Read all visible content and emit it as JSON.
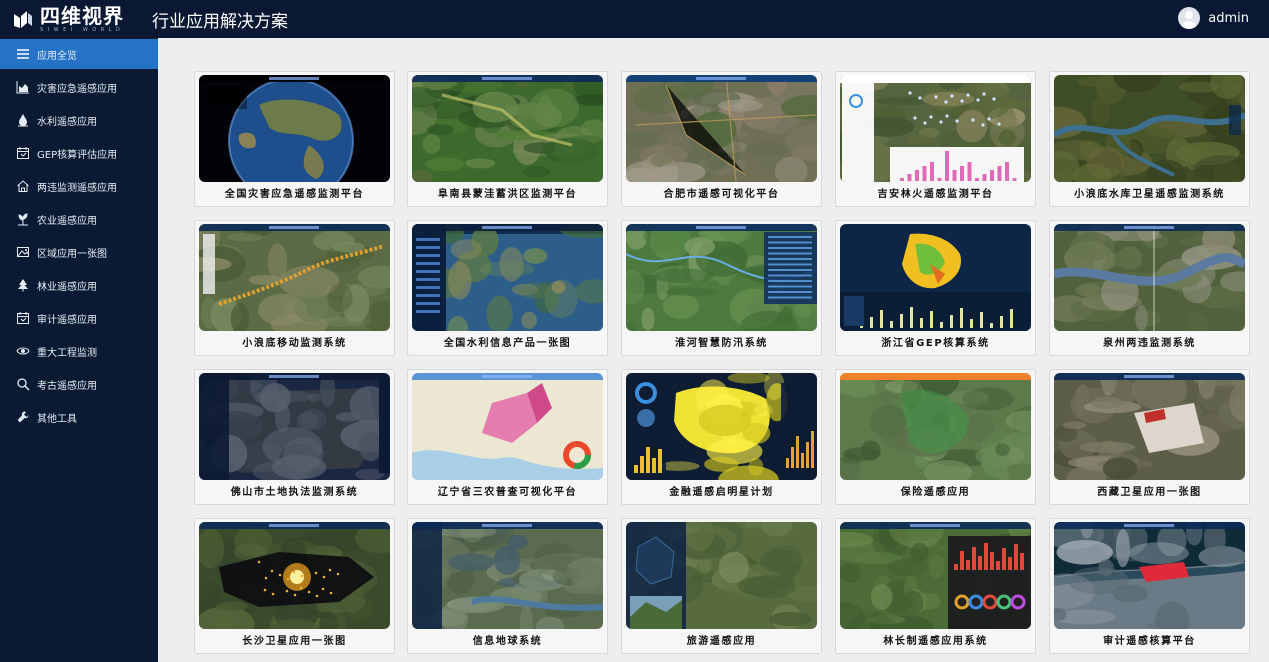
{
  "header": {
    "logo_text": "四维视界",
    "logo_sub": "SIWEI WORLD",
    "title": "行业应用解决方案",
    "username": "admin"
  },
  "sidebar": {
    "items": [
      {
        "label": "应用全览",
        "icon": "menu-icon",
        "active": true
      },
      {
        "label": "灾害应急遥感应用",
        "icon": "area-chart-icon",
        "active": false
      },
      {
        "label": "水利遥感应用",
        "icon": "water-drop-icon",
        "active": false
      },
      {
        "label": "GEP核算评估应用",
        "icon": "calendar-icon",
        "active": false
      },
      {
        "label": "两违监测遥感应用",
        "icon": "home-icon",
        "active": false
      },
      {
        "label": "农业遥感应用",
        "icon": "plant-icon",
        "active": false
      },
      {
        "label": "区域应用一张图",
        "icon": "image-icon",
        "active": false
      },
      {
        "label": "林业遥感应用",
        "icon": "tree-icon",
        "active": false
      },
      {
        "label": "审计遥感应用",
        "icon": "calendar-icon",
        "active": false
      },
      {
        "label": "重大工程监测",
        "icon": "eye-icon",
        "active": false
      },
      {
        "label": "考古遥感应用",
        "icon": "search-icon",
        "active": false
      },
      {
        "label": "其他工具",
        "icon": "wrench-icon",
        "active": false
      }
    ]
  },
  "cards": [
    {
      "title": "全国灾害应急遥感监测平台",
      "theme": "globe"
    },
    {
      "title": "阜南县蒙洼蓄洪区监测平台",
      "theme": "green"
    },
    {
      "title": "合肥市遥感可视化平台",
      "theme": "urban"
    },
    {
      "title": "吉安林火遥感监测平台",
      "theme": "chart-panel"
    },
    {
      "title": "小浪底水库卫星遥感监测系统",
      "theme": "river"
    },
    {
      "title": "小浪底移动监测系统",
      "theme": "terrain"
    },
    {
      "title": "全国水利信息产品一张图",
      "theme": "china-map"
    },
    {
      "title": "淮河智慧防汛系统",
      "theme": "flood"
    },
    {
      "title": "浙江省GEP核算系统",
      "theme": "gep"
    },
    {
      "title": "泉州两违监测系统",
      "theme": "city-river"
    },
    {
      "title": "佛山市土地执法监测系统",
      "theme": "dark-region"
    },
    {
      "title": "辽宁省三农普查可视化平台",
      "theme": "light-map"
    },
    {
      "title": "金融遥感启明星计划",
      "theme": "yellow-region"
    },
    {
      "title": "保险遥感应用",
      "theme": "insurance"
    },
    {
      "title": "西藏卫星应用一张图",
      "theme": "palace"
    },
    {
      "title": "长沙卫星应用一张图",
      "theme": "night-lights"
    },
    {
      "title": "信息地球系统",
      "theme": "info-earth"
    },
    {
      "title": "旅游遥感应用",
      "theme": "tourism"
    },
    {
      "title": "林长制遥感应用系统",
      "theme": "forest-chief"
    },
    {
      "title": "审计遥感核算平台",
      "theme": "audit-3d"
    }
  ]
}
